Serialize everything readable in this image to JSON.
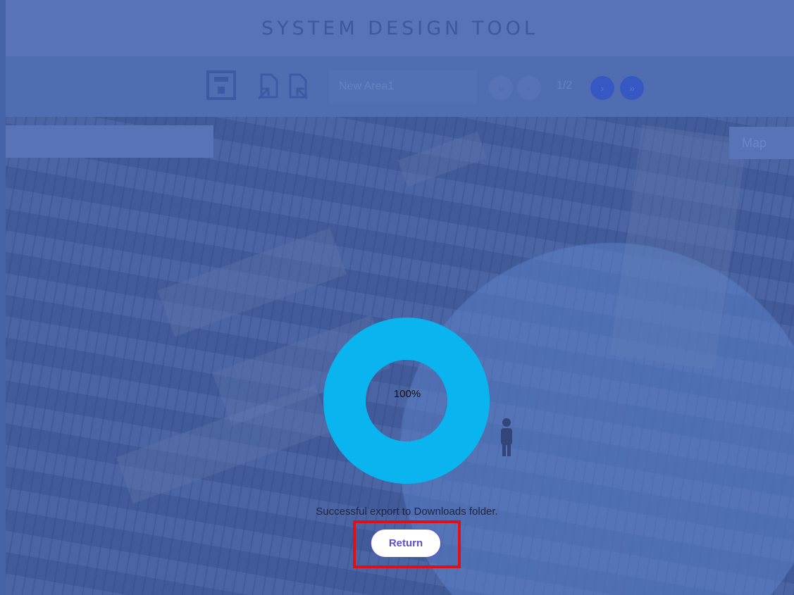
{
  "app": {
    "title": "SYSTEM DESIGN TOOL"
  },
  "toolbar": {
    "save_icon": "save-icon",
    "import_icon": "import-icon",
    "export_icon": "export-icon",
    "area_name": "New Area1",
    "page_indicator": "1/2",
    "first_icon": "double-chevron-left-icon",
    "prev_icon": "chevron-left-icon",
    "next_icon": "chevron-right-icon",
    "last_icon": "double-chevron-right-icon"
  },
  "map": {
    "view_button": "Map"
  },
  "export_dialog": {
    "progress_text": "100%",
    "progress_value": 1.0,
    "message": "Successful export to Downloads folder.",
    "return_label": "Return"
  },
  "colors": {
    "ring": "#0ab4ee",
    "highlight": "#e01018",
    "accent": "#5b4fd1"
  }
}
